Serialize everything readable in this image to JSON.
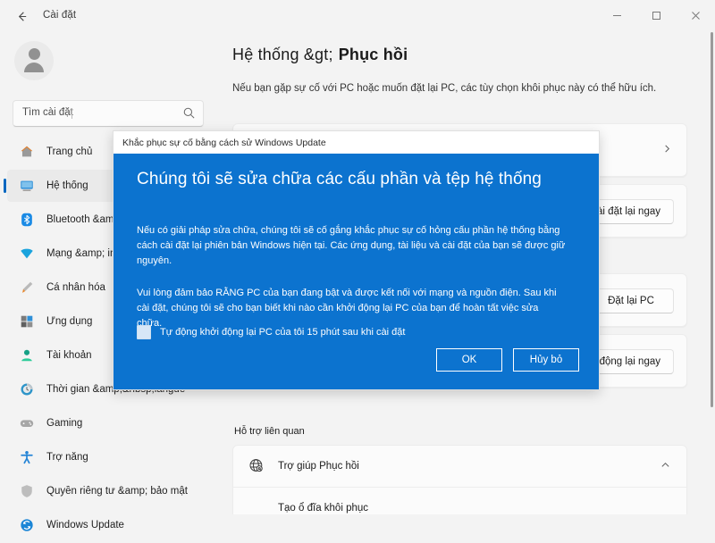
{
  "titlebar": {
    "back_icon": "back-arrow-icon",
    "app_title": "Cài đặt",
    "minimize": "minimize-icon",
    "maximize": "maximize-icon",
    "close": "close-icon"
  },
  "sidebar": {
    "avatar": "user-avatar",
    "search": {
      "placeholder": "Tìm cài đặt",
      "icon": "search-icon"
    },
    "items": [
      {
        "label": "Trang chủ",
        "icon": "home-icon",
        "active": false
      },
      {
        "label": "Hệ thống",
        "icon": "display-icon",
        "active": true
      },
      {
        "label": "Bluetooth &amp; de",
        "icon": "bluetooth-icon",
        "active": false
      },
      {
        "label": "Mạng &amp; intel",
        "icon": "wifi-icon",
        "active": false
      },
      {
        "label": "Cá nhân hóa",
        "icon": "brush-icon",
        "active": false
      },
      {
        "label": "Ứng dụng",
        "icon": "apps-icon",
        "active": false
      },
      {
        "label": "Tài khoản",
        "icon": "account-icon",
        "active": false
      },
      {
        "label": "Thời gian &amp;&nbsp;langue",
        "icon": "clock-icon",
        "active": false
      },
      {
        "label": "Gaming",
        "icon": "gamepad-icon",
        "active": false
      },
      {
        "label": "Trợ năng",
        "icon": "accessibility-icon",
        "active": false
      },
      {
        "label": "Quyền riêng tư &amp; bảo mật",
        "icon": "shield-icon",
        "active": false
      },
      {
        "label": "Windows Update",
        "icon": "update-icon",
        "active": false
      }
    ]
  },
  "main": {
    "breadcrumb": "Hệ thống &gt;",
    "page_leaf": "Phục hồi",
    "page_subtitle": "Nếu bạn gặp sự cố với PC hoặc muốn đặt lại PC, các tùy chọn khôi phục này có thể hữu ích.",
    "cards": [
      {
        "title": "",
        "desc": "",
        "action_type": "chevron",
        "action": "chevron-right-icon"
      },
      {
        "title": "",
        "desc": "",
        "action_type": "button",
        "action": "Cài đặt lại ngay"
      },
      {
        "title": "",
        "desc": "",
        "action_type": "button",
        "action": "Đặt lại PC"
      },
      {
        "title": "",
        "desc": "",
        "action_type": "button",
        "action": "Khởi động lại ngay"
      }
    ],
    "related_support_label": "Hỗ trợ liên quan",
    "help_rows": [
      {
        "label": "Trợ giúp Phục hồi",
        "icon": "globe-help-icon",
        "chevron": "chevron-up-icon"
      },
      {
        "label": "Tạo ổ đĩa khôi phục",
        "icon": "",
        "chevron": ""
      }
    ]
  },
  "dialog": {
    "titlebar_text": "Khắc phục sự cố bằng cách sử Windows Update",
    "heading": "Chúng tôi sẽ sửa chữa các cấu phần và tệp hệ thống",
    "paragraph1": "Nếu có giải pháp sửa chữa, chúng tôi sẽ cố gắng khắc phục sự cố hỏng cấu phần hệ thống bằng cách cài đặt lại phiên bản Windows hiện tại. Các ứng dụng, tài liệu và cài đặt của bạn sẽ được giữ nguyên.",
    "paragraph2": "Vui lòng đảm bảo RẰNG PC của bạn đang bật và được kết nối với mạng và nguồn điện. Sau khi cài đặt, chúng tôi sẽ cho bạn biết khi nào cần khởi động lại PC của bạn để hoàn tất việc sửa chữa.",
    "checkbox_label": "Tự động khởi động lại PC của tôi 15 phút sau khi cài đặt",
    "checkbox_checked": false,
    "ok_label": "OK",
    "cancel_label": "Hủy bỏ",
    "accent_color": "#0c73cf"
  }
}
